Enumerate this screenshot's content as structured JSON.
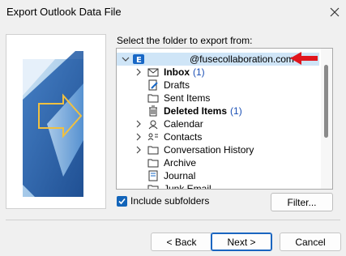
{
  "window": {
    "title": "Export Outlook Data File"
  },
  "main": {
    "prompt": "Select the folder to export from:",
    "tree": {
      "account": "@fusecollaboration.com",
      "items": [
        {
          "label": "Inbox",
          "count": "(1)",
          "bold": true
        },
        {
          "label": "Drafts",
          "count": "",
          "bold": false
        },
        {
          "label": "Sent Items",
          "count": "",
          "bold": false
        },
        {
          "label": "Deleted Items",
          "count": "(1)",
          "bold": true
        },
        {
          "label": "Calendar",
          "count": "",
          "bold": false
        },
        {
          "label": "Contacts",
          "count": "",
          "bold": false
        },
        {
          "label": "Conversation History",
          "count": "",
          "bold": false
        },
        {
          "label": "Archive",
          "count": "",
          "bold": false
        },
        {
          "label": "Journal",
          "count": "",
          "bold": false
        },
        {
          "label": "Junk Email",
          "count": "",
          "bold": false
        }
      ]
    },
    "include_subfolders": {
      "label": "Include subfolders",
      "checked": true
    },
    "filter_button": "Filter..."
  },
  "footer": {
    "back": "< Back",
    "next": "Next >",
    "cancel": "Cancel"
  },
  "colors": {
    "accent": "#1264b9",
    "annotation_arrow": "#e0161e",
    "selection": "#cfe5f7"
  }
}
